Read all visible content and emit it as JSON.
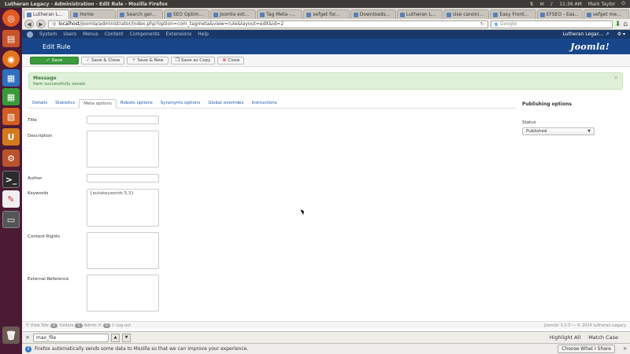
{
  "system": {
    "window_title": "Lutheran Legacy - Administration - Edit Rule - Mozilla Firefox",
    "time": "11:36 AM",
    "user": "Mark Taylor"
  },
  "launcher": [
    "ubuntu-dash-icon",
    "files-icon",
    "firefox-icon",
    "writer-icon",
    "calc-icon",
    "impress-icon",
    "software-center-icon",
    "settings-icon",
    "terminal-icon",
    "shotwell-icon",
    "workspace-icon",
    "trash-icon"
  ],
  "browser": {
    "tabs": [
      {
        "label": "Lutheran L...",
        "active": true
      },
      {
        "label": "Home"
      },
      {
        "label": "Search ger..."
      },
      {
        "label": "SEO Optim..."
      },
      {
        "label": "Joomla ext..."
      },
      {
        "label": "Tag Meta -..."
      },
      {
        "label": "sefget for..."
      },
      {
        "label": "Downloads..."
      },
      {
        "label": "Lutheran L..."
      },
      {
        "label": "Use canoni..."
      },
      {
        "label": "Easy Front..."
      },
      {
        "label": "EFSEO - Eas..."
      },
      {
        "label": "sefget me..."
      }
    ],
    "url_host": "localhost",
    "url_rest": "/joomla/administrator/index.php?option=com_tagmeta&view=rule&layout=edit&id=2",
    "search_engine": "Google",
    "search_placeholder": "Google"
  },
  "joomla": {
    "nav": [
      "System",
      "Users",
      "Menus",
      "Content",
      "Components",
      "Extensions",
      "Help"
    ],
    "site_name": "Lutheran Legac...",
    "page_title": "Edit Rule",
    "brand": "Joomla!",
    "toolbar": {
      "save": "Save",
      "save_close": "Save & Close",
      "save_new": "Save & New",
      "save_copy": "Save as Copy",
      "close": "Close"
    },
    "message": {
      "heading": "Message",
      "text": "Item successfully saved."
    },
    "tabs": [
      "Details",
      "Statistics",
      "Meta options",
      "Robots options",
      "Synonyms options",
      "Global overrides",
      "Instructions"
    ],
    "fields": {
      "title_label": "Title",
      "title_value": "",
      "description_label": "Description",
      "description_value": "",
      "author_label": "Author",
      "author_value": "",
      "keywords_label": "Keywords",
      "keywords_value": "{autokeywords 5,3}",
      "rights_label": "Content Rights",
      "rights_value": "",
      "external_label": "External Reference",
      "external_value": ""
    },
    "publishing": {
      "title": "Publishing options",
      "status_label": "Status",
      "status_value": "Published"
    },
    "status": {
      "view_site": "View Site",
      "visitors_count": "0",
      "visitors": "Visitors",
      "admins_count": "1",
      "admins": "Admin",
      "messages_count": "0",
      "logout": "Log out",
      "footer": "Joomla! 3.2.3 — © 2014 Lutheran Legacy"
    }
  },
  "findbar": {
    "value": "max_file",
    "highlight_all": "Highlight All",
    "match_case": "Match Case"
  },
  "notification": {
    "text": "Firefox automatically sends some data to Mozilla so that we can improve your experience.",
    "button": "Choose What I Share"
  }
}
